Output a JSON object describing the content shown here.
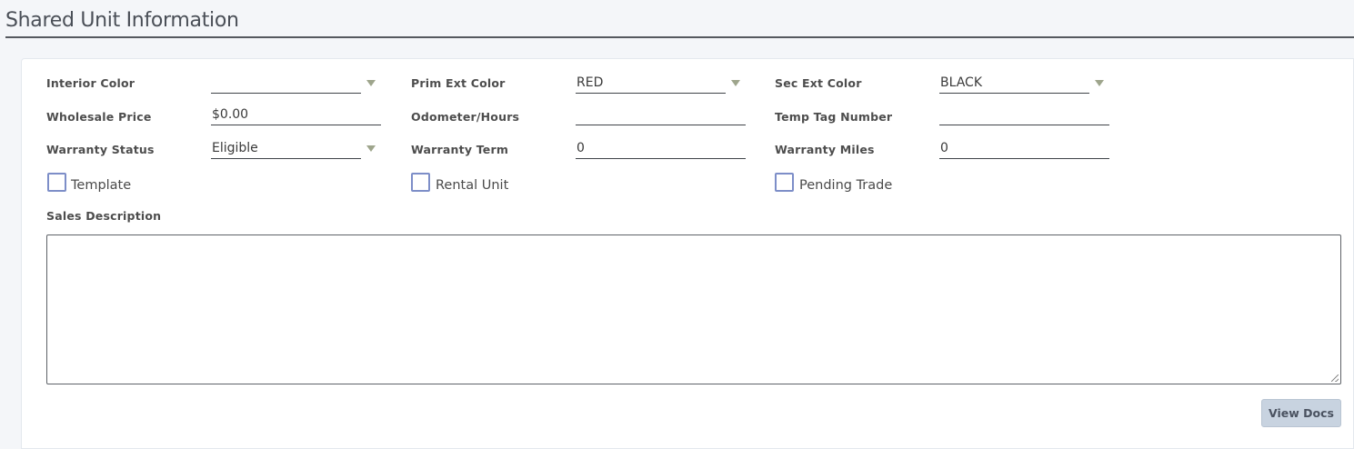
{
  "section": {
    "title": "Shared Unit Information"
  },
  "fields": {
    "interior_color": {
      "label": "Interior Color",
      "value": ""
    },
    "prim_ext_color": {
      "label": "Prim Ext Color",
      "value": "RED"
    },
    "sec_ext_color": {
      "label": "Sec Ext Color",
      "value": "BLACK"
    },
    "wholesale_price": {
      "label": "Wholesale Price",
      "value": "$0.00"
    },
    "odometer_hours": {
      "label": "Odometer/Hours",
      "value": ""
    },
    "temp_tag_number": {
      "label": "Temp Tag Number",
      "value": ""
    },
    "warranty_status": {
      "label": "Warranty Status",
      "value": "Eligible"
    },
    "warranty_term": {
      "label": "Warranty Term",
      "value": "0"
    },
    "warranty_miles": {
      "label": "Warranty Miles",
      "value": "0"
    }
  },
  "checkboxes": {
    "template": {
      "label": "Template",
      "checked": false
    },
    "rental_unit": {
      "label": "Rental Unit",
      "checked": false
    },
    "pending_trade": {
      "label": "Pending Trade",
      "checked": false
    }
  },
  "sales_description": {
    "label": "Sales Description",
    "value": ""
  },
  "buttons": {
    "view_docs": "View Docs"
  },
  "colors": {
    "checkbox_border": "#7d8ec8",
    "caret": "#9ea58c",
    "button_bg": "#c8d3e0"
  },
  "icons": {
    "dropdown": "caret-down-icon"
  }
}
